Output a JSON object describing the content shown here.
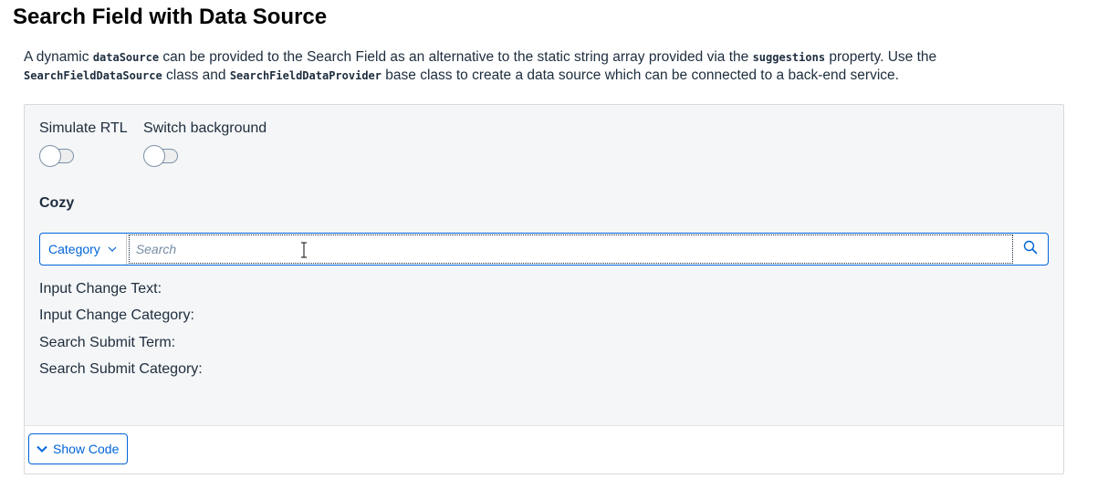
{
  "page": {
    "title": "Search Field with Data Source"
  },
  "description": {
    "text_1": "A dynamic ",
    "code_1": "dataSource",
    "text_2": " can be provided to the Search Field as an alternative to the static string array provided via the ",
    "code_2": "suggestions",
    "text_3": " property. Use the ",
    "code_3": "SearchFieldDataSource",
    "text_4": " class and ",
    "code_4": "SearchFieldDataProvider",
    "text_5": " base class to create a data source which can be connected to a back-end service."
  },
  "example": {
    "toggles": [
      {
        "label": "Simulate RTL",
        "checked": false
      },
      {
        "label": "Switch background",
        "checked": false
      }
    ],
    "section_heading": "Cozy",
    "search": {
      "category_label": "Category",
      "placeholder": "Search",
      "value": ""
    },
    "outputs": {
      "input_change_text": "Input Change Text:",
      "input_change_category": "Input Change Category:",
      "search_submit_term": "Search Submit Term:",
      "search_submit_category": "Search Submit Category:"
    },
    "show_code_label": "Show Code"
  },
  "colors": {
    "accent": "#0064d9",
    "text": "#1d2d3e",
    "example_background": "#f5f6f7",
    "placeholder": "#758ca4"
  },
  "icons": [
    "chevron-down-icon",
    "search-icon",
    "text-cursor-icon"
  ]
}
